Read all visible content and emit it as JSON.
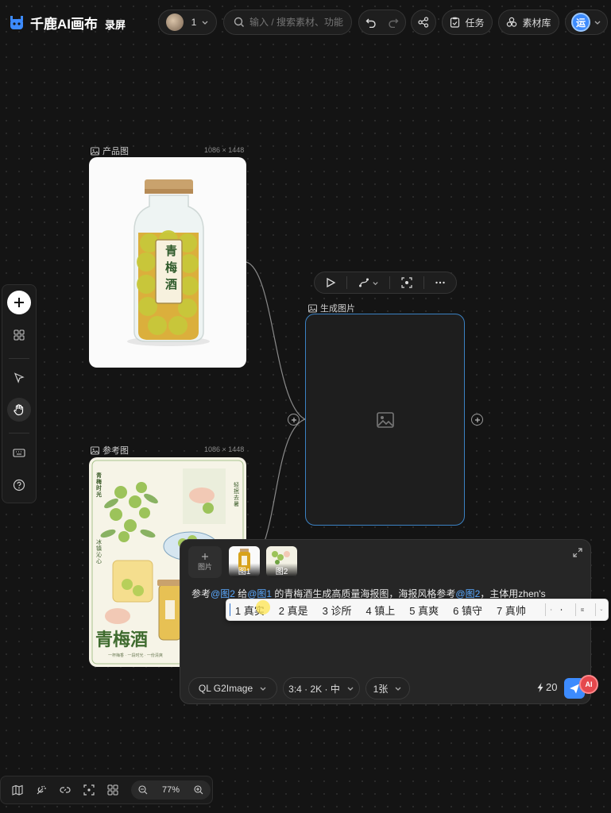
{
  "header": {
    "logo_text": "千鹿AI画布",
    "record_label": "录屏",
    "user_count": "1",
    "search_placeholder": "输入 / 搜索素材、功能",
    "task_label": "任务",
    "library_label": "素材库",
    "avatar_letter": "运"
  },
  "nodes": {
    "product": {
      "title": "产品图",
      "dims": "1086 × 1448",
      "bottle_label": "青梅酒"
    },
    "reference": {
      "title": "参考图",
      "dims": "1086 × 1448",
      "poster_title": "青梅酒",
      "poster_side_left": "青梅时光",
      "poster_side_right": "轻抿去暑",
      "poster_side_mid": "冰镇沁心",
      "poster_footer": "一杯梅香 · 一段时光 · 一份清爽"
    },
    "generate": {
      "title": "生成图片"
    }
  },
  "prompt": {
    "add_label": "图片",
    "thumbs": [
      "图1",
      "图2"
    ],
    "text_segments": [
      {
        "t": "参考",
        "m": false
      },
      {
        "t": "@图2",
        "m": true
      },
      {
        "t": " 给",
        "m": false
      },
      {
        "t": "@图1",
        "m": true
      },
      {
        "t": " 的青梅酒生成高质量海报图，海报风格参考",
        "m": false
      },
      {
        "t": "@图2",
        "m": true
      },
      {
        "t": "，主体用zhen's",
        "m": false
      }
    ],
    "model": "QL G2Image",
    "ratio": "3:4 · 2K · 中",
    "count": "1张",
    "credits": "20",
    "ai_badge": "AI"
  },
  "ime": {
    "candidates": [
      "1 真实",
      "2 真是",
      "3 诊所",
      "4 镇上",
      "5 真爽",
      "6 镇守",
      "7 真帅"
    ]
  },
  "bottom": {
    "zoom": "77%"
  },
  "colors": {
    "accent": "#3d8bfd",
    "mention": "#5aa9ff",
    "node_border": "#3b82c4",
    "ai_badge": "#e5484d"
  }
}
